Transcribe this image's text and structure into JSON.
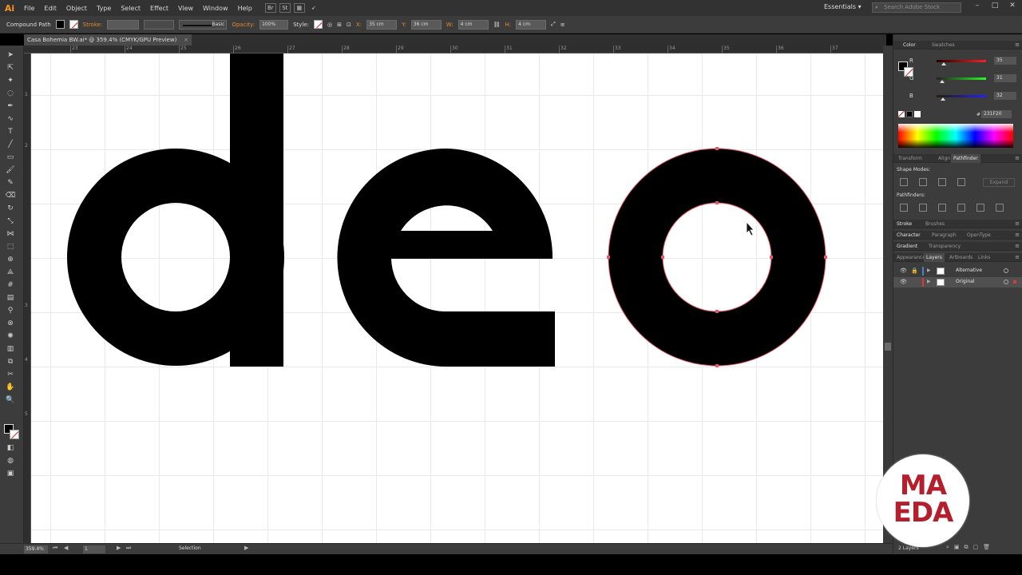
{
  "app": {
    "logo": "Ai",
    "menu": [
      "File",
      "Edit",
      "Object",
      "Type",
      "Select",
      "Effect",
      "View",
      "Window",
      "Help"
    ],
    "bridge_buttons": [
      "Br",
      "St"
    ],
    "workspace": "Essentials",
    "search_placeholder": "Search Adobe Stock"
  },
  "control_bar": {
    "selection_type": "Compound Path",
    "stroke_label": "Stroke:",
    "brush_label": "Basic",
    "opacity_label": "Opacity:",
    "opacity_value": "100%",
    "style_label": "Style:",
    "x_label": "X:",
    "x_value": "35 cm",
    "y_label": "Y:",
    "y_value": "36 cm",
    "w_label": "W:",
    "w_value": "4 cm",
    "h_label": "H:",
    "h_value": "4 cm"
  },
  "document": {
    "tab_title": "Casa Bohemia BW.ai* @ 359.4% (CMYK/GPU Preview)",
    "close": "×",
    "canvas_text": "deo"
  },
  "rulers": {
    "top": [
      "23",
      "24",
      "25",
      "26",
      "27",
      "28",
      "29",
      "30",
      "31",
      "32",
      "33",
      "34",
      "35",
      "36",
      "37"
    ],
    "left": [
      "1",
      "2",
      "3",
      "4",
      "5"
    ]
  },
  "status_bar": {
    "zoom": "359.4%",
    "artboard": "1",
    "tool": "Selection"
  },
  "panels": {
    "color_tabs": [
      "Color",
      "Swatches"
    ],
    "rgb": [
      {
        "label": "R",
        "value": "35",
        "fraction": 0.14
      },
      {
        "label": "G",
        "value": "31",
        "fraction": 0.12
      },
      {
        "label": "B",
        "value": "32",
        "fraction": 0.125
      }
    ],
    "hex_label": "#",
    "hex_value": "231F20",
    "tab_group_1": [
      "Transform",
      "Align",
      "Pathfinder"
    ],
    "shape_modes_label": "Shape Modes:",
    "expand_label": "Expand",
    "pathfinders_label": "Pathfinders:",
    "tab_group_2": [
      "Stroke",
      "Brushes"
    ],
    "tab_group_3": [
      "Character",
      "Paragraph",
      "OpenType"
    ],
    "tab_group_4": [
      "Gradient",
      "Transparency"
    ],
    "tab_group_5": [
      "Appearance",
      "Layers",
      "Artboards",
      "Links"
    ],
    "layers": [
      {
        "name": "Alternative",
        "color": "#4a7fd4"
      },
      {
        "name": "Original",
        "color": "#d83b3b"
      }
    ],
    "layers_count": "2 Layers"
  },
  "brand": {
    "line1": "MA",
    "line2": "EDA",
    "color": "#b41f2e"
  }
}
